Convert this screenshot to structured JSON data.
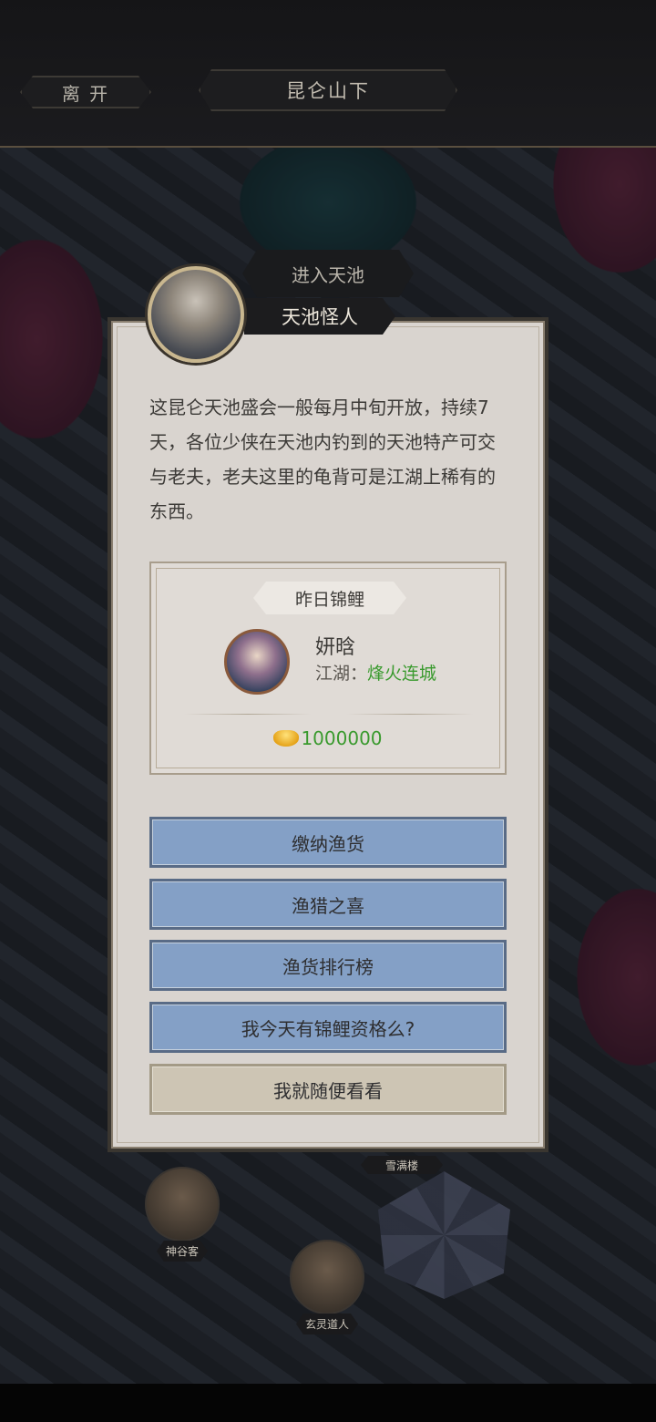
{
  "header": {
    "leave_label": "离 开",
    "title": "昆仑山下"
  },
  "enter_label": "进入天池",
  "npc": {
    "name": "天池怪人"
  },
  "dialog": {
    "text": "这昆仑天池盛会一般每月中旬开放，持续7天，各位少侠在天池内钓到的天池特产可交与老夫，老夫这里的龟背可是江湖上稀有的东西。"
  },
  "koi": {
    "title": "昨日锦鲤",
    "player_name": "妍晗",
    "guild_prefix": "江湖：",
    "guild_name": "烽火连城",
    "reward_amount": "1000000",
    "reward_icon": "gold-ingot-icon"
  },
  "options": [
    {
      "label": "缴纳渔货"
    },
    {
      "label": "渔猎之喜"
    },
    {
      "label": "渔货排行榜"
    },
    {
      "label": "我今天有锦鲤资格么?"
    },
    {
      "label": "我就随便看看"
    }
  ],
  "map_labels": {
    "npc1": "神谷客",
    "npc2": "玄灵道人",
    "building": "雪满楼"
  },
  "colors": {
    "guild_green": "#3a9a2e",
    "option_blue": "#84a0c6"
  }
}
